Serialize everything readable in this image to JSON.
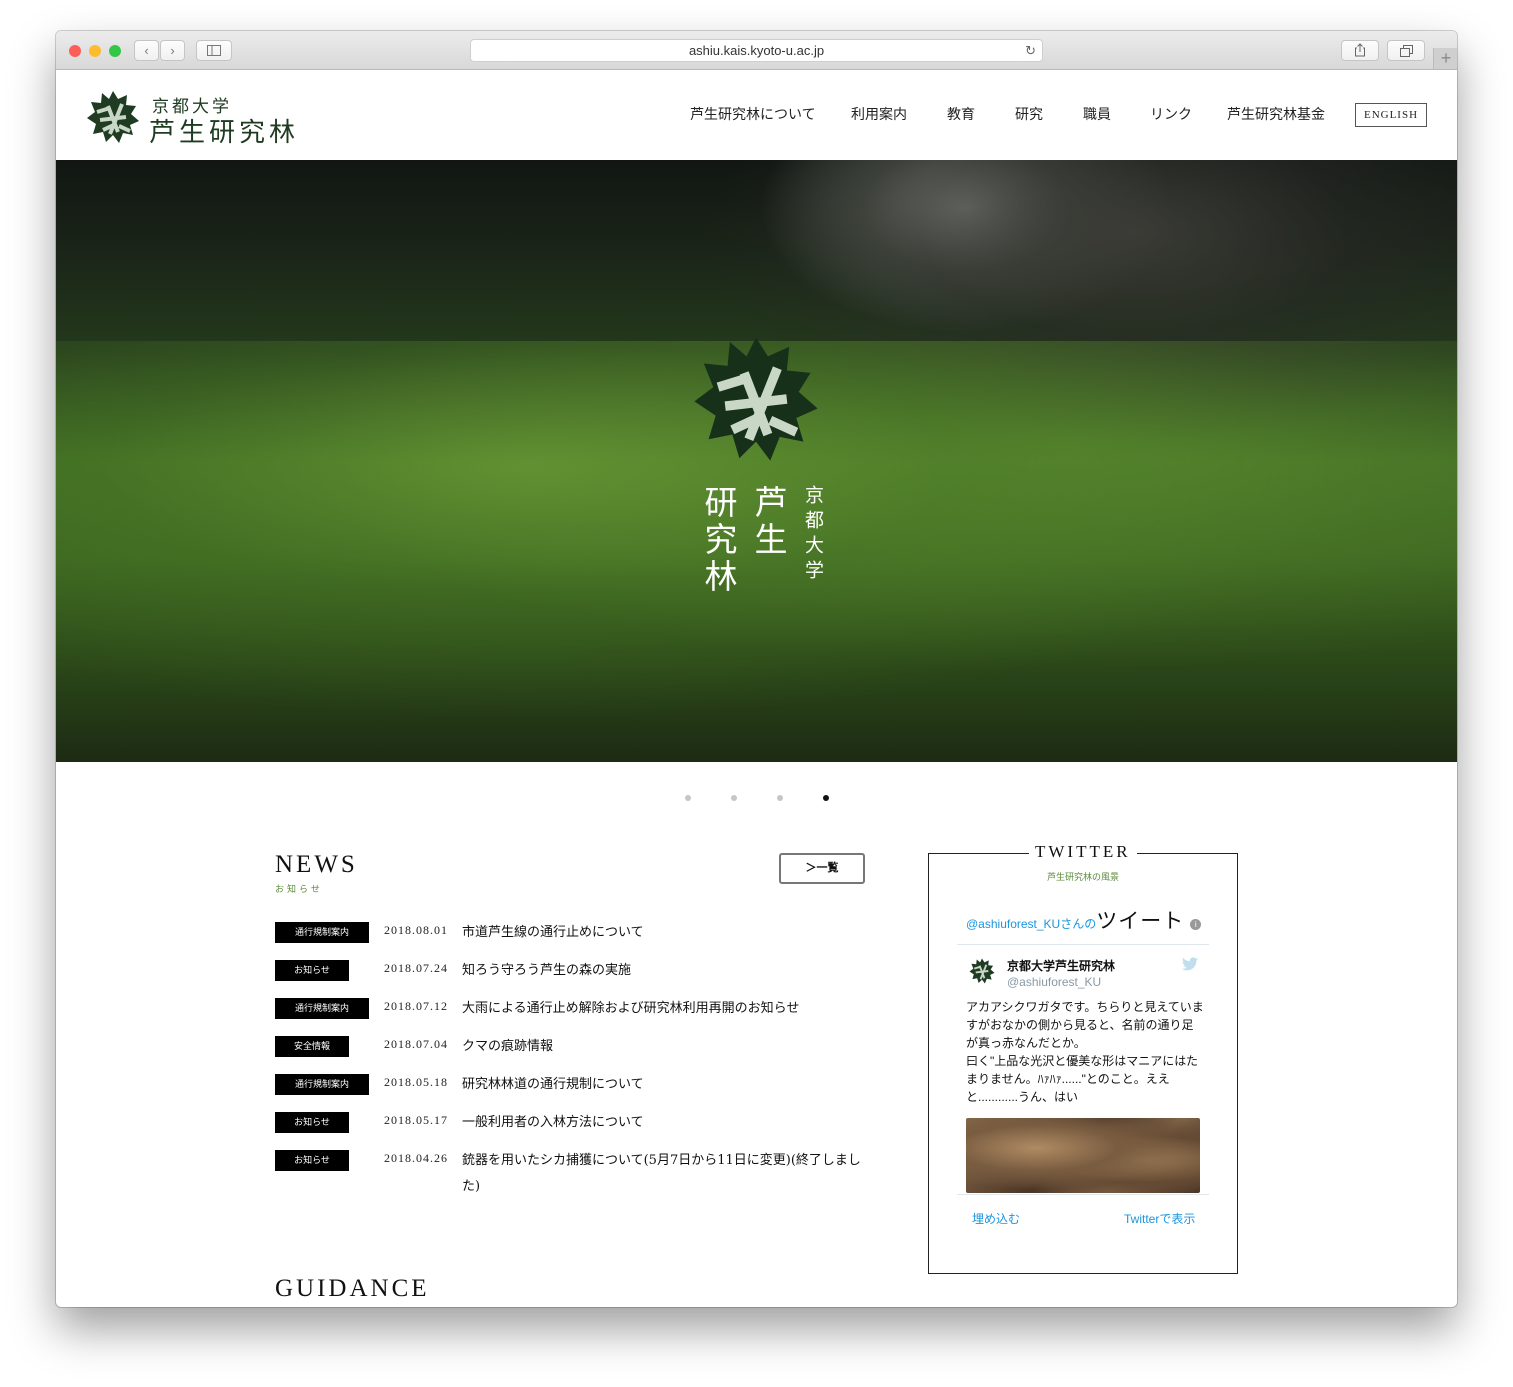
{
  "browser": {
    "url": "ashiu.kais.kyoto-u.ac.jp",
    "colors": {
      "close": "#fc5f57",
      "minimize": "#fdbc2e",
      "zoom": "#33c748"
    }
  },
  "site": {
    "logo_top": "京都大学",
    "logo_main": "芦生研究林",
    "nav": [
      "芦生研究林について",
      "利用案内",
      "教育",
      "研究",
      "職員",
      "リンク",
      "芦生研究林基金"
    ],
    "english_label": "ENGLISH"
  },
  "hero": {
    "vertical_text": [
      "京都大学",
      "芦生",
      "研究林"
    ],
    "slides": 4,
    "active_slide": 4
  },
  "news": {
    "title": "NEWS",
    "subtitle": "お知らせ",
    "more_label": "＞一覧",
    "items": [
      {
        "category": "通行規制案内",
        "date": "2018.08.01",
        "title": "市道芦生線の通行止めについて"
      },
      {
        "category": "お知らせ",
        "date": "2018.07.24",
        "title": "知ろう守ろう芦生の森の実施"
      },
      {
        "category": "通行規制案内",
        "date": "2018.07.12",
        "title": "大雨による通行止め解除および研究林利用再開のお知らせ"
      },
      {
        "category": "安全情報",
        "date": "2018.07.04",
        "title": "クマの痕跡情報"
      },
      {
        "category": "通行規制案内",
        "date": "2018.05.18",
        "title": "研究林林道の通行規制について"
      },
      {
        "category": "お知らせ",
        "date": "2018.05.17",
        "title": "一般利用者の入林方法について"
      },
      {
        "category": "お知らせ",
        "date": "2018.04.26",
        "title": "銃器を用いたシカ捕獲について(5月7日から11日に変更)(終了しました)"
      }
    ]
  },
  "guidance": {
    "title": "GUIDANCE"
  },
  "twitter": {
    "title": "TWITTER",
    "subtitle": "芦生研究林の風景",
    "handle_prefix": "@ashiuforest_KUさんの",
    "handle_suffix": "ツイート",
    "account_name": "京都大学芦生研究林",
    "account_handle": "@ashiuforest_KU",
    "tweet_text": "アカアシクワガタです。ちらりと見えていますがおなかの側から見ると、名前の通り足が真っ赤なんだとか。\n曰く\"上品な光沢と優美な形はマニアにはたまりません。ﾊｧﾊｧ......\"とのこと。ええと............うん、はい",
    "embed_label": "埋め込む",
    "view_label": "Twitterで表示",
    "link_color": "#1b95e0"
  },
  "colors": {
    "brand_green": "#1f3b22",
    "accent_green": "#5b8a39",
    "badge_bg": "#000000"
  }
}
